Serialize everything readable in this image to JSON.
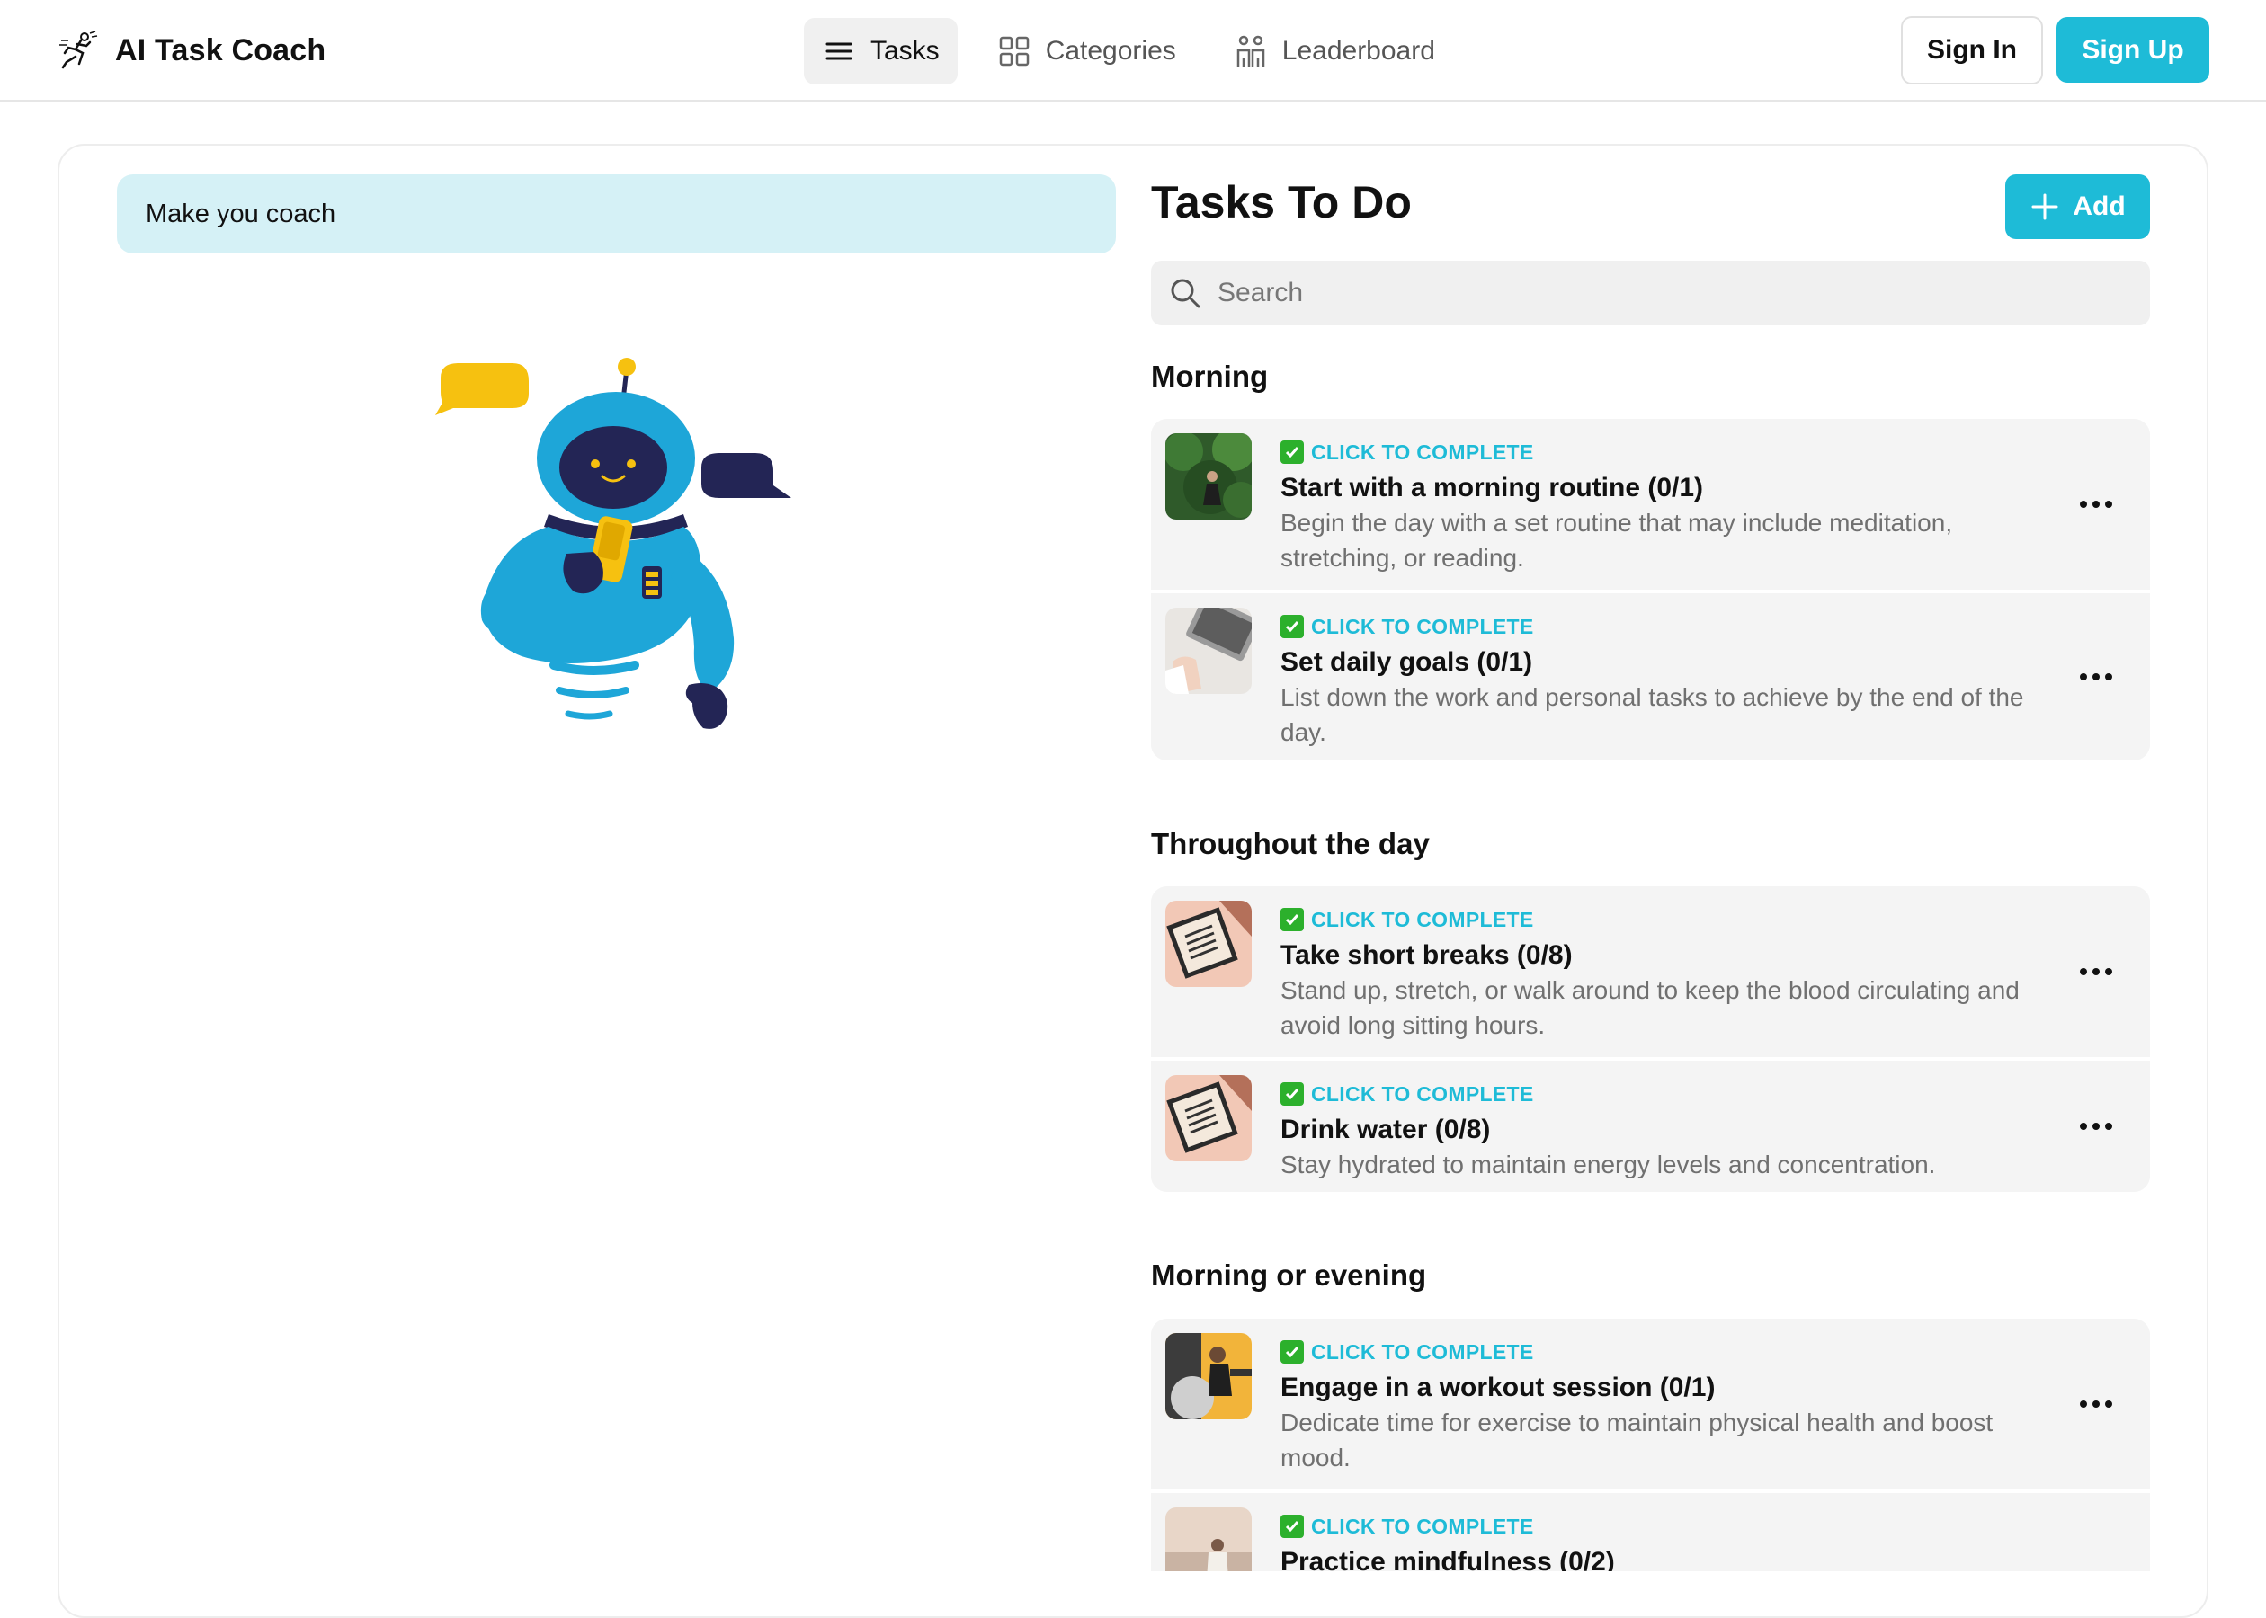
{
  "header": {
    "brand": "AI Task Coach",
    "nav": [
      {
        "label": "Tasks",
        "icon": "list-icon",
        "active": true
      },
      {
        "label": "Categories",
        "icon": "grid-icon",
        "active": false
      },
      {
        "label": "Leaderboard",
        "icon": "people-icon",
        "active": false
      }
    ],
    "sign_in": "Sign In",
    "sign_up": "Sign Up"
  },
  "coach": {
    "prompt": "Make you coach"
  },
  "tasks": {
    "title": "Tasks To Do",
    "add_label": "Add",
    "search_placeholder": "Search",
    "complete_label": "CLICK TO COMPLETE",
    "sections": [
      {
        "title": "Morning",
        "items": [
          {
            "title": "Start with a morning routine (0/1)",
            "description": "Begin the day with a set routine that may include meditation, stretching, or reading."
          },
          {
            "title": "Set daily goals (0/1)",
            "description": "List down the work and personal tasks to achieve by the end of the day."
          }
        ]
      },
      {
        "title": "Throughout the day",
        "items": [
          {
            "title": "Take short breaks (0/8)",
            "description": "Stand up, stretch, or walk around to keep the blood circulating and avoid long sitting hours."
          },
          {
            "title": "Drink water (0/8)",
            "description": "Stay hydrated to maintain energy levels and concentration."
          }
        ]
      },
      {
        "title": "Morning or evening",
        "items": [
          {
            "title": "Engage in a workout session (0/1)",
            "description": "Dedicate time for exercise to maintain physical health and boost mood."
          },
          {
            "title": "Practice mindfulness (0/2)",
            "description": ""
          }
        ]
      }
    ]
  },
  "colors": {
    "accent": "#1ebbd7",
    "coach_bg": "#d5f1f6",
    "check_green": "#2cb02c",
    "card_bg": "#f4f4f4"
  }
}
